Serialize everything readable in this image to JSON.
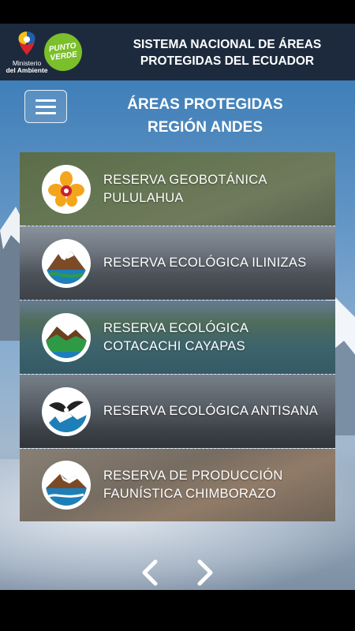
{
  "header": {
    "ministerio_line1": "Ministerio",
    "ministerio_line2": "del Ambiente",
    "punto_line1": "PUNTO",
    "punto_line2": "VERDE",
    "title_line1": "SISTEMA NACIONAL DE ÁREAS",
    "title_line2": "PROTEGIDAS DEL ECUADOR"
  },
  "page": {
    "menu_icon": "hamburger-menu-icon",
    "title_line1": "ÁREAS PROTEGIDAS",
    "title_line2": "REGIÓN ANDES"
  },
  "areas": [
    {
      "line1": "RESERVA GEOBOTÁNICA",
      "line2": "PULULAHUA",
      "icon": "orchid-icon"
    },
    {
      "line1": "RESERVA ECOLÓGICA ILINIZAS",
      "line2": "",
      "icon": "mountain-river-icon"
    },
    {
      "line1": "RESERVA ECOLÓGICA",
      "line2": "COTACACHI CAYAPAS",
      "icon": "green-hills-icon"
    },
    {
      "line1": "RESERVA ECOLÓGICA ANTISANA",
      "line2": "",
      "icon": "condor-icon"
    },
    {
      "line1": "RESERVA DE PRODUCCIÓN",
      "line2": "FAUNÍSTICA CHIMBORAZO",
      "icon": "snowy-mountain-icon"
    }
  ],
  "nav": {
    "prev_icon": "chevron-left-icon",
    "next_icon": "chevron-right-icon"
  },
  "colors": {
    "header_bg": "#1d2a3d",
    "punto_verde": "#7bbf2a",
    "sky": "#5f93c4"
  }
}
